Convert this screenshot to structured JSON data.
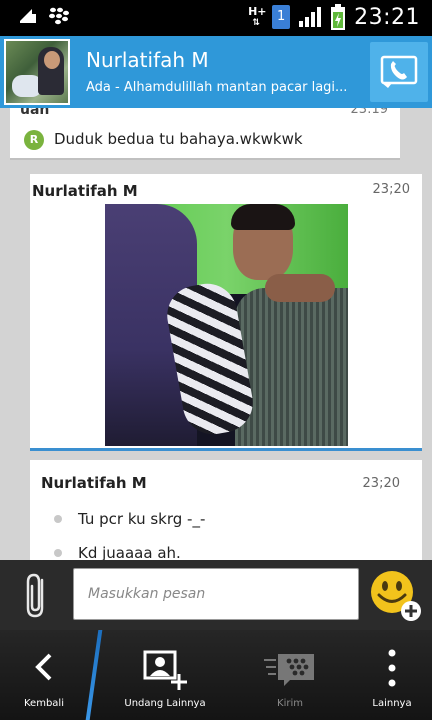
{
  "status_bar": {
    "network": "H+",
    "notification_badge": "1",
    "time": "23:21",
    "icons": [
      "download-arrow-icon",
      "blackberry-icon",
      "signal-icon",
      "battery-charging-icon"
    ]
  },
  "header": {
    "contact_name": "Nurlatifah M",
    "status_message": "Ada - Alhamdulillah mantan pacar lagi...",
    "call_icon": "phone-icon"
  },
  "chat": {
    "messages": [
      {
        "sender_partial": "uan",
        "time": "23:19",
        "status_icon_letter": "R",
        "text": "Duduk bedua tu bahaya.wkwkwk"
      },
      {
        "sender": "Nurlatifah M",
        "time": "23;20",
        "type": "photo"
      },
      {
        "sender": "Nurlatifah M",
        "time": "23;20",
        "lines": [
          "Tu pcr ku skrg -_-",
          "Kd juaaaa ah."
        ]
      }
    ]
  },
  "input": {
    "placeholder": "Masukkan pesan",
    "attach_icon": "paperclip-icon",
    "emoji_icon": "smiley-add-icon"
  },
  "bottom_nav": {
    "items": [
      {
        "label": "Kembali",
        "icon": "back-chevron-icon"
      },
      {
        "label": "Undang Lainnya",
        "icon": "invite-contact-icon"
      },
      {
        "label": "Kirim",
        "icon": "send-bbm-icon"
      },
      {
        "label": "Lainnya",
        "icon": "overflow-menu-icon"
      }
    ]
  },
  "colors": {
    "header_blue": "#2f98d9",
    "call_button_blue": "#4fb2ea",
    "read_green": "#7ab33e",
    "smiley_yellow": "#f2c31c"
  }
}
